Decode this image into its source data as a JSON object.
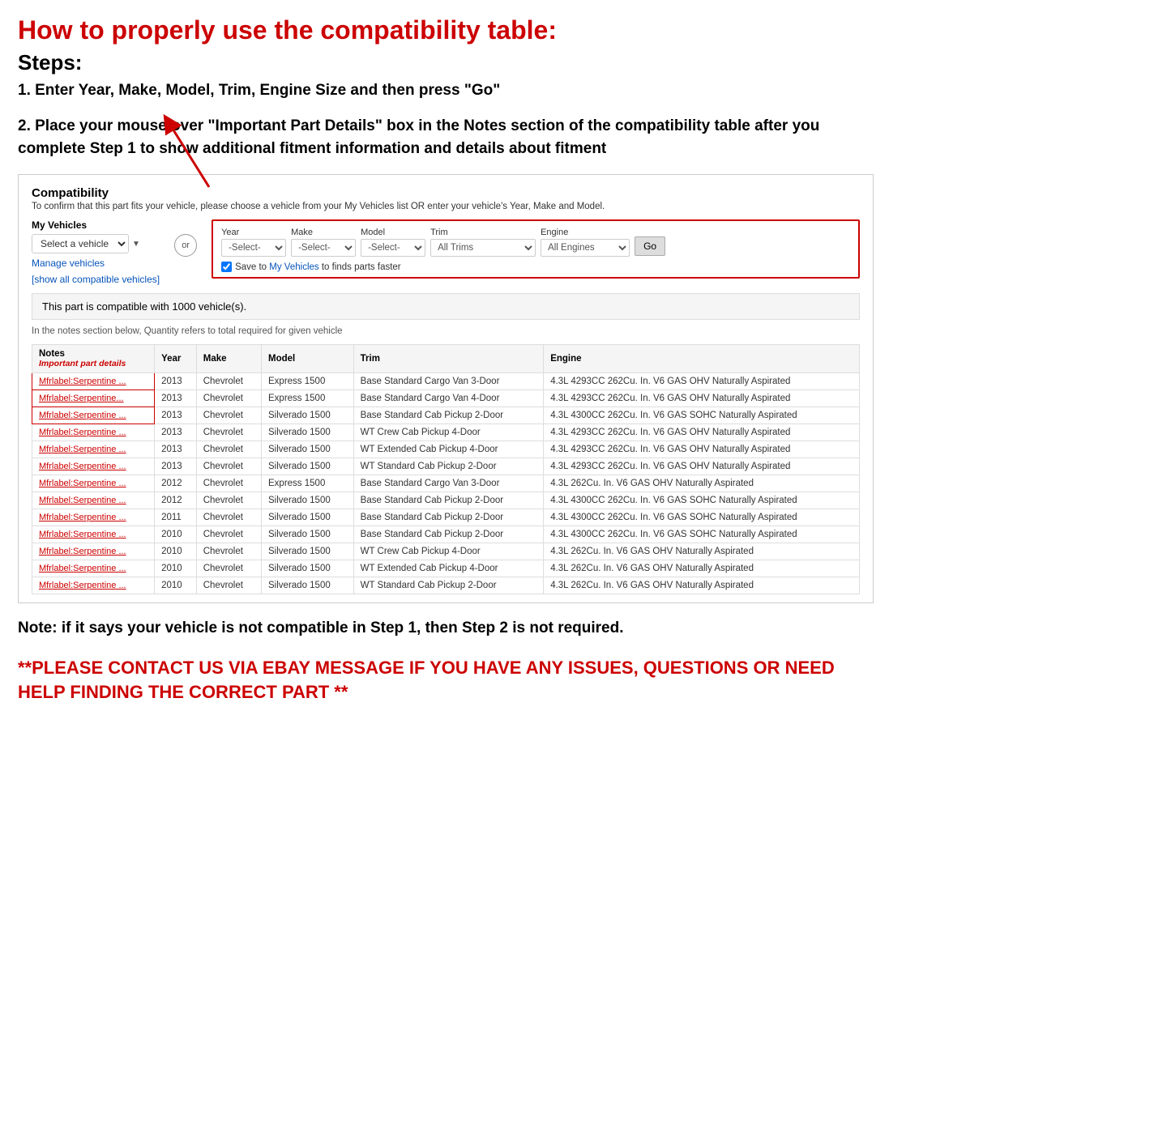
{
  "page": {
    "main_title": "How to properly use the compatibility table:",
    "steps_heading": "Steps:",
    "step1": "1. Enter Year, Make, Model, Trim, Engine Size and then press \"Go\"",
    "step2": "2. Place your mouse over \"Important Part Details\" box in the Notes section of the compatibility table after you complete Step 1 to show additional fitment information and details about fitment",
    "note_section": "Note: if it says your vehicle is not compatible in Step 1, then Step 2 is not required.",
    "contact_section": "**PLEASE CONTACT US VIA EBAY MESSAGE IF YOU HAVE ANY ISSUES, QUESTIONS OR NEED HELP FINDING THE CORRECT PART **"
  },
  "compatibility": {
    "title": "Compatibility",
    "subtitle": "To confirm that this part fits your vehicle, please choose a vehicle from your My Vehicles list OR enter your vehicle's Year, Make and Model.",
    "my_vehicles_label": "My Vehicles",
    "select_vehicle_placeholder": "Select a vehicle",
    "manage_vehicles": "Manage vehicles",
    "show_all": "[show all compatible vehicles]",
    "or_label": "or",
    "year_label": "Year",
    "year_placeholder": "-Select-",
    "make_label": "Make",
    "make_placeholder": "-Select-",
    "model_label": "Model",
    "model_placeholder": "-Select-",
    "trim_label": "Trim",
    "trim_value": "All Trims",
    "engine_label": "Engine",
    "engine_value": "All Engines",
    "go_button": "Go",
    "save_text": "Save to My Vehicles to finds parts faster",
    "compat_msg": "This part is compatible with 1000 vehicle(s).",
    "compat_note": "In the notes section below, Quantity refers to total required for given vehicle",
    "table_headers": [
      "Notes",
      "Year",
      "Make",
      "Model",
      "Trim",
      "Engine"
    ],
    "notes_sub": "Important part details",
    "table_rows": [
      {
        "notes": "Mfrlabel:Serpentine ...",
        "year": "2013",
        "make": "Chevrolet",
        "model": "Express 1500",
        "trim": "Base Standard Cargo Van 3-Door",
        "engine": "4.3L 4293CC 262Cu. In. V6 GAS OHV Naturally Aspirated",
        "highlight": true
      },
      {
        "notes": "Mfrlabel:Serpentine...",
        "year": "2013",
        "make": "Chevrolet",
        "model": "Express 1500",
        "trim": "Base Standard Cargo Van 4-Door",
        "engine": "4.3L 4293CC 262Cu. In. V6 GAS OHV Naturally Aspirated",
        "highlight": true
      },
      {
        "notes": "Mfrlabel:Serpentine ...",
        "year": "2013",
        "make": "Chevrolet",
        "model": "Silverado 1500",
        "trim": "Base Standard Cab Pickup 2-Door",
        "engine": "4.3L 4300CC 262Cu. In. V6 GAS SOHC Naturally Aspirated",
        "highlight": true
      },
      {
        "notes": "Mfrlabel:Serpentine ...",
        "year": "2013",
        "make": "Chevrolet",
        "model": "Silverado 1500",
        "trim": "WT Crew Cab Pickup 4-Door",
        "engine": "4.3L 4293CC 262Cu. In. V6 GAS OHV Naturally Aspirated",
        "highlight": false
      },
      {
        "notes": "Mfrlabel:Serpentine ...",
        "year": "2013",
        "make": "Chevrolet",
        "model": "Silverado 1500",
        "trim": "WT Extended Cab Pickup 4-Door",
        "engine": "4.3L 4293CC 262Cu. In. V6 GAS OHV Naturally Aspirated",
        "highlight": false
      },
      {
        "notes": "Mfrlabel:Serpentine ...",
        "year": "2013",
        "make": "Chevrolet",
        "model": "Silverado 1500",
        "trim": "WT Standard Cab Pickup 2-Door",
        "engine": "4.3L 4293CC 262Cu. In. V6 GAS OHV Naturally Aspirated",
        "highlight": false
      },
      {
        "notes": "Mfrlabel:Serpentine ...",
        "year": "2012",
        "make": "Chevrolet",
        "model": "Express 1500",
        "trim": "Base Standard Cargo Van 3-Door",
        "engine": "4.3L 262Cu. In. V6 GAS OHV Naturally Aspirated",
        "highlight": false
      },
      {
        "notes": "Mfrlabel:Serpentine ...",
        "year": "2012",
        "make": "Chevrolet",
        "model": "Silverado 1500",
        "trim": "Base Standard Cab Pickup 2-Door",
        "engine": "4.3L 4300CC 262Cu. In. V6 GAS SOHC Naturally Aspirated",
        "highlight": false
      },
      {
        "notes": "Mfrlabel:Serpentine ...",
        "year": "2011",
        "make": "Chevrolet",
        "model": "Silverado 1500",
        "trim": "Base Standard Cab Pickup 2-Door",
        "engine": "4.3L 4300CC 262Cu. In. V6 GAS SOHC Naturally Aspirated",
        "highlight": false
      },
      {
        "notes": "Mfrlabel:Serpentine ...",
        "year": "2010",
        "make": "Chevrolet",
        "model": "Silverado 1500",
        "trim": "Base Standard Cab Pickup 2-Door",
        "engine": "4.3L 4300CC 262Cu. In. V6 GAS SOHC Naturally Aspirated",
        "highlight": false
      },
      {
        "notes": "Mfrlabel:Serpentine ...",
        "year": "2010",
        "make": "Chevrolet",
        "model": "Silverado 1500",
        "trim": "WT Crew Cab Pickup 4-Door",
        "engine": "4.3L 262Cu. In. V6 GAS OHV Naturally Aspirated",
        "highlight": false
      },
      {
        "notes": "Mfrlabel:Serpentine ...",
        "year": "2010",
        "make": "Chevrolet",
        "model": "Silverado 1500",
        "trim": "WT Extended Cab Pickup 4-Door",
        "engine": "4.3L 262Cu. In. V6 GAS OHV Naturally Aspirated",
        "highlight": false
      },
      {
        "notes": "Mfrlabel:Serpentine ...",
        "year": "2010",
        "make": "Chevrolet",
        "model": "Silverado 1500",
        "trim": "WT Standard Cab Pickup 2-Door",
        "engine": "4.3L 262Cu. In. V6 GAS OHV Naturally Aspirated",
        "highlight": false
      }
    ]
  }
}
